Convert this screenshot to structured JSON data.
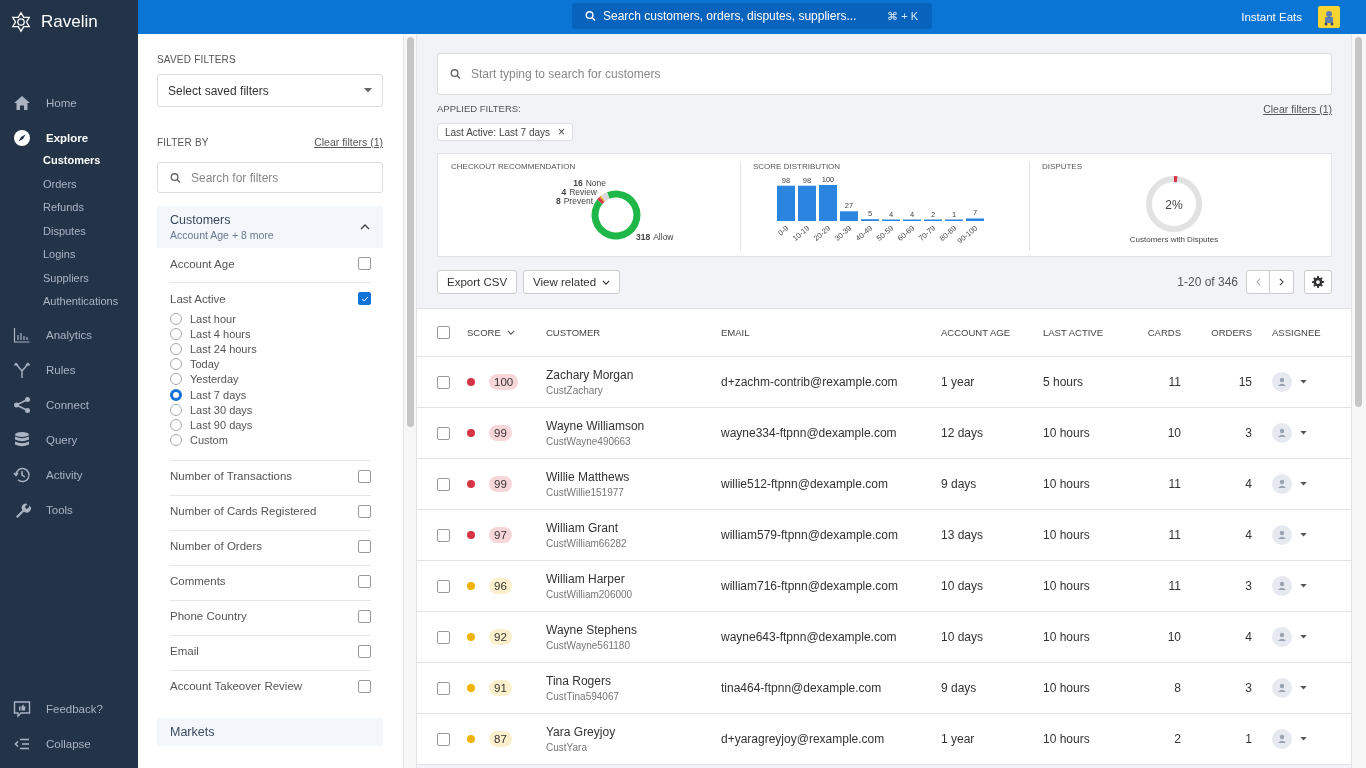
{
  "brand": "Ravelin",
  "nav": [
    {
      "label": "Home",
      "selected": false
    },
    {
      "label": "Explore",
      "selected": true,
      "children": [
        {
          "label": "Customers",
          "selected": true
        },
        {
          "label": "Orders",
          "selected": false
        },
        {
          "label": "Refunds",
          "selected": false
        },
        {
          "label": "Disputes",
          "selected": false
        },
        {
          "label": "Logins",
          "selected": false
        },
        {
          "label": "Suppliers",
          "selected": false
        },
        {
          "label": "Authentications",
          "selected": false
        }
      ]
    },
    {
      "label": "Analytics",
      "selected": false
    },
    {
      "label": "Rules",
      "selected": false
    },
    {
      "label": "Connect",
      "selected": false
    },
    {
      "label": "Query",
      "selected": false
    },
    {
      "label": "Activity",
      "selected": false
    },
    {
      "label": "Tools",
      "selected": false
    }
  ],
  "nav_footer": [
    {
      "label": "Feedback?"
    },
    {
      "label": "Collapse"
    }
  ],
  "topbar": {
    "search_placeholder": "Search customers, orders, disputes, suppliers...",
    "shortcut": "⌘ + K",
    "account": "Instant Eats"
  },
  "filters": {
    "saved_title": "SAVED FILTERS",
    "saved_select": "Select saved filters",
    "filter_by": "FILTER BY",
    "clear": "Clear filters (1)",
    "search_placeholder": "Search for filters",
    "groups": [
      {
        "title": "Customers",
        "subtitle": "Account Age + 8 more",
        "expanded": true,
        "items": [
          {
            "label": "Account Age",
            "checked": false
          },
          {
            "label": "Last Active",
            "checked": true,
            "options": [
              {
                "label": "Last hour",
                "selected": false
              },
              {
                "label": "Last 4 hours",
                "selected": false
              },
              {
                "label": "Last 24 hours",
                "selected": false
              },
              {
                "label": "Today",
                "selected": false
              },
              {
                "label": "Yesterday",
                "selected": false
              },
              {
                "label": "Last 7 days",
                "selected": true
              },
              {
                "label": "Last 30 days",
                "selected": false
              },
              {
                "label": "Last 90 days",
                "selected": false
              },
              {
                "label": "Custom",
                "selected": false
              }
            ]
          },
          {
            "label": "Number of Transactions",
            "checked": false
          },
          {
            "label": "Number of Cards Registered",
            "checked": false
          },
          {
            "label": "Number of Orders",
            "checked": false
          },
          {
            "label": "Comments",
            "checked": false
          },
          {
            "label": "Phone Country",
            "checked": false
          },
          {
            "label": "Email",
            "checked": false
          },
          {
            "label": "Account Takeover Review",
            "checked": false
          }
        ]
      },
      {
        "title": "Markets"
      }
    ]
  },
  "search": {
    "placeholder": "Start typing to search for customers"
  },
  "applied": {
    "label": "APPLIED FILTERS:",
    "clear": "Clear filters (1)",
    "chips": [
      {
        "label": "Last Active: Last 7 days",
        "remove": "×"
      }
    ]
  },
  "summary": {
    "checkout": {
      "title": "CHECKOUT RECOMMENDATION",
      "chart_data": {
        "type": "donut",
        "data_labels": true,
        "categories": [
          "None",
          "Review",
          "Prevent",
          "Allow"
        ],
        "series": [
          {
            "values": [
              16,
              4,
              8,
              318
            ],
            "colors": [
              "#d9d9d9",
              "#f0a020",
              "#d63447",
              "#1fb848"
            ]
          }
        ]
      }
    },
    "scores": {
      "title": "SCORE DISTRIBUTION",
      "chart_data": {
        "type": "bar",
        "data_labels": true,
        "categories": [
          "0-9",
          "10-19",
          "20-29",
          "30-39",
          "40-49",
          "50-59",
          "60-69",
          "70-79",
          "80-89",
          "90-100"
        ],
        "series": [
          {
            "color": "#2a85e0",
            "values": [
              98,
              98,
              100,
              27,
              5,
              4,
              4,
              2,
              1,
              7
            ]
          }
        ]
      }
    },
    "disputes": {
      "title": "DISPUTES",
      "reading": "2%",
      "caption": "Customers with Disputes"
    }
  },
  "toolbar": {
    "export": "Export CSV",
    "view_related": "View related",
    "range": "1-20 of 346"
  },
  "table": {
    "select_all_checked": false,
    "columns": [
      "SCORE",
      "CUSTOMER",
      "EMAIL",
      "ACCOUNT AGE",
      "LAST ACTIVE",
      "CARDS",
      "ORDERS",
      "ASSIGNEE"
    ],
    "rows": [
      {
        "checked": false,
        "color": "#d63447",
        "score": "100",
        "name": "Zachary Morgan",
        "id": "CustZachary",
        "email": "d+zachm-contrib@rexample.com",
        "age": "1 year",
        "last_active": "5 hours",
        "cards": "11",
        "orders": "15"
      },
      {
        "checked": false,
        "color": "#d63447",
        "score": "99",
        "name": "Wayne Williamson",
        "id": "CustWayne490663",
        "email": "wayne334-ftpnn@dexample.com",
        "age": "12 days",
        "last_active": "10 hours",
        "cards": "10",
        "orders": "3"
      },
      {
        "checked": false,
        "color": "#d63447",
        "score": "99",
        "name": "Willie Matthews",
        "id": "CustWillie151977",
        "email": "willie512-ftpnn@dexample.com",
        "age": "9 days",
        "last_active": "10 hours",
        "cards": "11",
        "orders": "4"
      },
      {
        "checked": false,
        "color": "#d63447",
        "score": "97",
        "name": "William Grant",
        "id": "CustWilliam66282",
        "email": "william579-ftpnn@dexample.com",
        "age": "13 days",
        "last_active": "10 hours",
        "cards": "11",
        "orders": "4"
      },
      {
        "checked": false,
        "color": "#f0b400",
        "score": "96",
        "name": "William Harper",
        "id": "CustWilliam206000",
        "email": "william716-ftpnn@dexample.com",
        "age": "10 days",
        "last_active": "10 hours",
        "cards": "11",
        "orders": "3"
      },
      {
        "checked": false,
        "color": "#f0b400",
        "score": "92",
        "name": "Wayne Stephens",
        "id": "CustWayne561180",
        "email": "wayne643-ftpnn@dexample.com",
        "age": "10 days",
        "last_active": "10 hours",
        "cards": "10",
        "orders": "4"
      },
      {
        "checked": false,
        "color": "#f0b400",
        "score": "91",
        "name": "Tina Rogers",
        "id": "CustTina594067",
        "email": "tina464-ftpnn@dexample.com",
        "age": "9 days",
        "last_active": "10 hours",
        "cards": "8",
        "orders": "3"
      },
      {
        "checked": false,
        "color": "#f0b400",
        "score": "87",
        "name": "Yara Greyjoy",
        "id": "CustYara",
        "email": "d+yaragreyjoy@rexample.com",
        "age": "1 year",
        "last_active": "10 hours",
        "cards": "2",
        "orders": "1"
      }
    ]
  }
}
